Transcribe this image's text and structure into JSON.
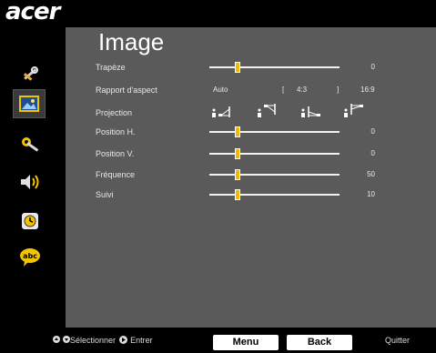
{
  "brand": {
    "logo_text": "acer"
  },
  "sidebar": {
    "items": [
      {
        "icon": "wrench-pencil-icon"
      },
      {
        "icon": "image-icon",
        "selected": true
      },
      {
        "icon": "settings-gear-icon"
      },
      {
        "icon": "speaker-icon"
      },
      {
        "icon": "timer-icon"
      },
      {
        "icon": "language-abc-icon"
      }
    ]
  },
  "panel": {
    "title": "Image",
    "rows": {
      "trapeze": {
        "label": "Trapèze",
        "value": "0"
      },
      "aspect": {
        "label": "Rapport d'aspect",
        "opt_auto": "Auto",
        "bracket_l": "[",
        "opt_43": "4:3",
        "bracket_r": "]",
        "opt_169": "16:9"
      },
      "projection": {
        "label": "Projection",
        "icons": [
          "front-desk-icon",
          "front-ceiling-icon",
          "rear-desk-icon",
          "rear-ceiling-icon"
        ]
      },
      "pos_h": {
        "label": "Position H.",
        "value": "0"
      },
      "pos_v": {
        "label": "Position V.",
        "value": "0"
      },
      "frequence": {
        "label": "Fréquence",
        "value": "50"
      },
      "suivi": {
        "label": "Suivi",
        "value": "10"
      }
    }
  },
  "footer": {
    "nav_arrows": "◆◆",
    "select_label": "Sélectionner",
    "enter_label": "Entrer",
    "menu_button": "Menu",
    "back_button": "Back",
    "quit_label": "Quitter"
  },
  "colors": {
    "panel": "#5a5a5a",
    "knob": "#f5b800",
    "accent_border": "#f2c200"
  }
}
